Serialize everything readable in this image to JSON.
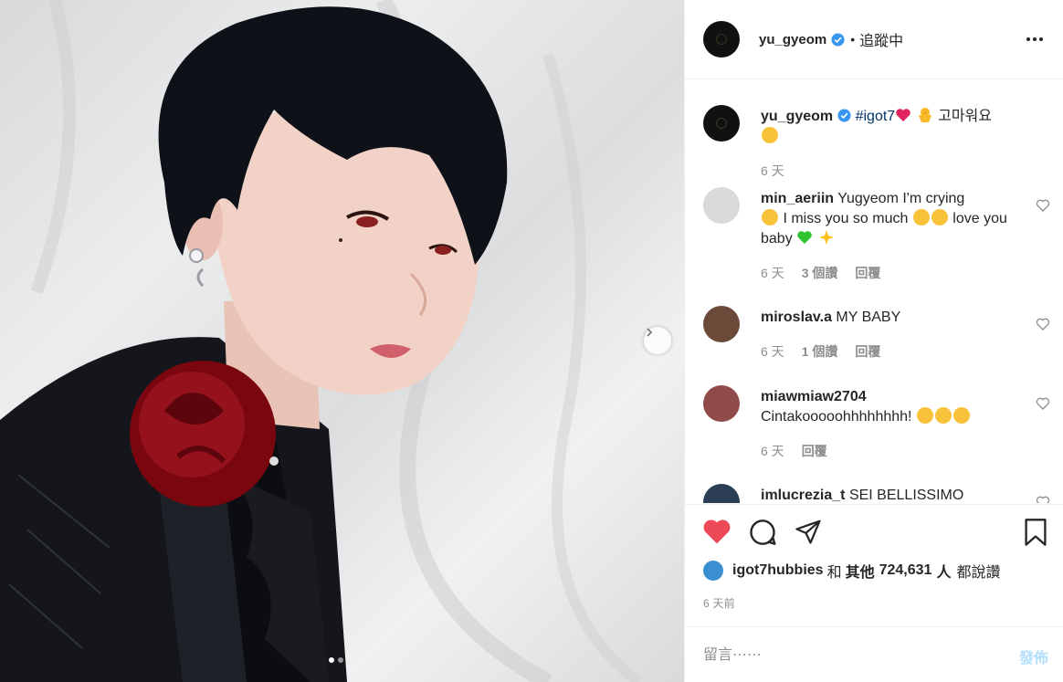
{
  "post": {
    "author": "yu_gyeom",
    "follow_status": "追蹤中",
    "separator": "•",
    "caption_hashtag": "#igot7",
    "caption_text": "고마워요",
    "caption_time": "6 天"
  },
  "comments": [
    {
      "user": "min_aeriin",
      "text_a": "Yugyeom I'm crying",
      "text_b": "I miss you so much",
      "text_c": "love you baby",
      "time": "6 天",
      "likes": "3 個讚",
      "reply": "回覆"
    },
    {
      "user": "miroslav.a",
      "text": "MY BABY",
      "time": "6 天",
      "likes": "1 個讚",
      "reply": "回覆"
    },
    {
      "user": "miawmiaw2704",
      "text": "Cintakooooohhhhhhhh!",
      "time": "6 天",
      "reply": "回覆"
    },
    {
      "user": "imlucrezia_t",
      "text": "SEI BELLISSIMO"
    }
  ],
  "likes_bar": {
    "user": "igot7hubbies",
    "and": "和",
    "others_prefix": "其他",
    "count": "724,631",
    "suffix": "人",
    "liked": "都說讚"
  },
  "timestamp": "6 天前",
  "comment_input": {
    "placeholder": "留言⋯⋯",
    "post_label": "發佈"
  },
  "colors": {
    "liked_heart": "#ed4956",
    "verified": "#3897f0",
    "hashtag": "#00376b",
    "post_disabled": "#b2dffc"
  },
  "icons": [
    "verified-badge-icon",
    "more-options-icon",
    "heart-icon",
    "comment-icon",
    "share-icon",
    "bookmark-icon",
    "next-arrow-icon"
  ]
}
